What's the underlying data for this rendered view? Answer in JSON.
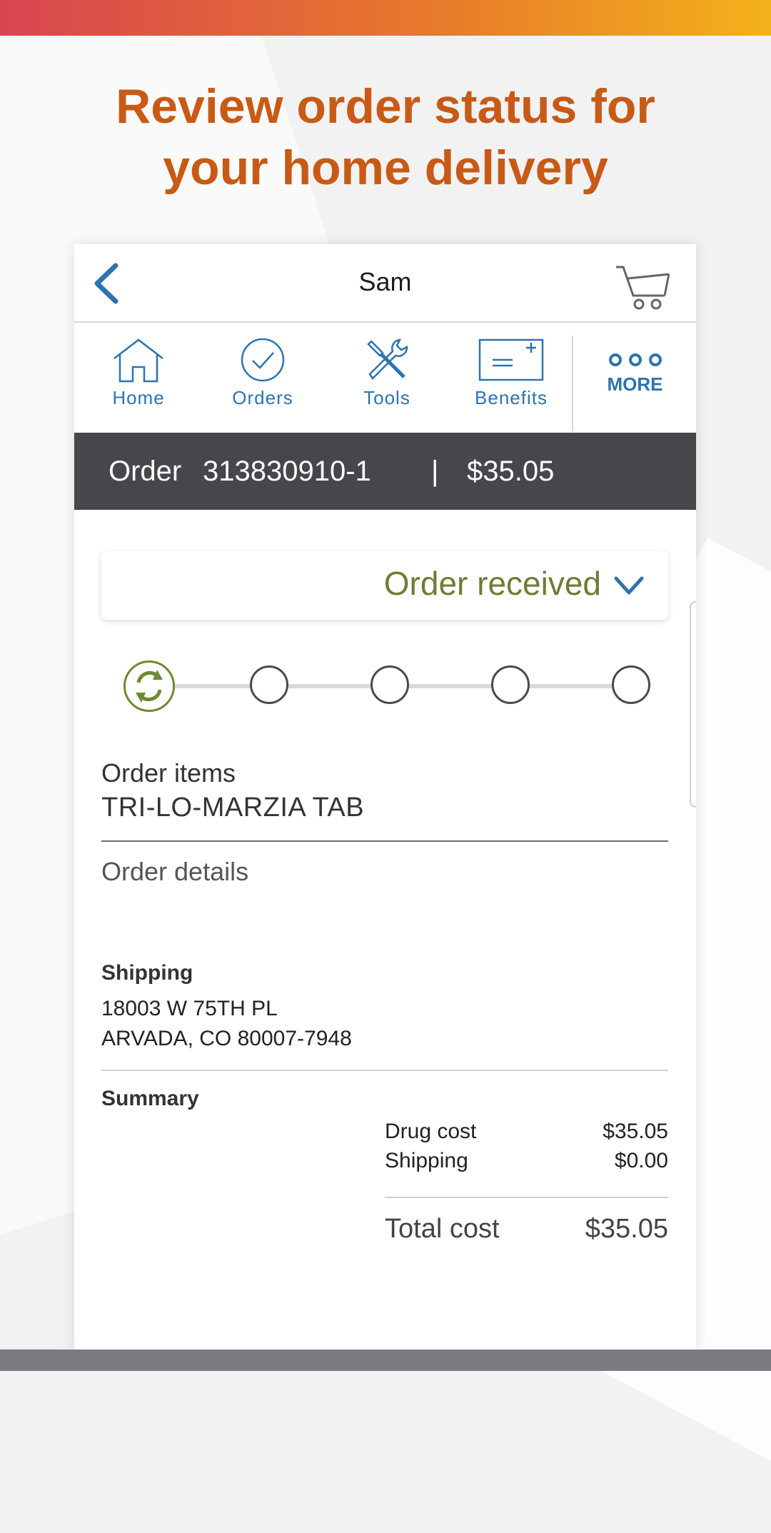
{
  "promo": {
    "line1": "Review order status for",
    "line2": "your home delivery"
  },
  "header": {
    "title": "Sam",
    "back_icon": "chevron-left-icon",
    "cart_icon": "cart-icon"
  },
  "nav": {
    "items": [
      {
        "label": "Home",
        "icon": "home-icon"
      },
      {
        "label": "Orders",
        "icon": "check-circle-icon"
      },
      {
        "label": "Tools",
        "icon": "tools-icon"
      },
      {
        "label": "Benefits",
        "icon": "benefits-card-icon"
      }
    ],
    "more_label": "MORE"
  },
  "order": {
    "label": "Order",
    "number": "313830910-1",
    "separator": "|",
    "amount": "$35.05"
  },
  "status": {
    "text": "Order received",
    "steps_total": 5,
    "current_step": 1,
    "active_color": "#6b7d35"
  },
  "items": {
    "label": "Order items",
    "value": "TRI-LO-MARZIA TAB"
  },
  "details": {
    "label": "Order details"
  },
  "shipping": {
    "heading": "Shipping",
    "line1": "18003 W 75TH PL",
    "line2": "ARVADA, CO 80007-7948"
  },
  "summary": {
    "heading": "Summary",
    "drug_cost_label": "Drug cost",
    "drug_cost_value": "$35.05",
    "shipping_label": "Shipping",
    "shipping_value": "$0.00",
    "total_label": "Total cost",
    "total_value": "$35.05"
  },
  "colors": {
    "brand_orange": "#c85a16",
    "link_blue": "#2e73b0",
    "order_bar": "#46474a"
  }
}
